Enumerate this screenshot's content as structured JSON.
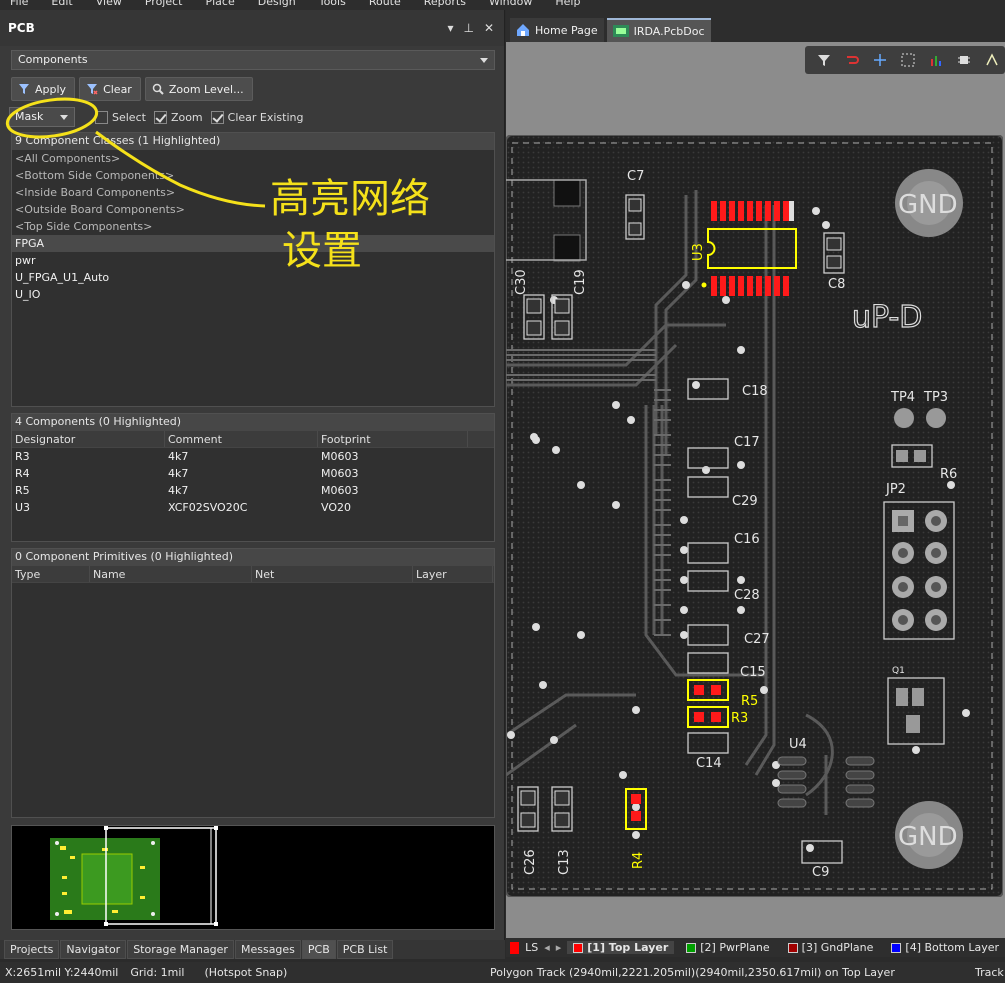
{
  "menu": [
    "File",
    "Edit",
    "View",
    "Project",
    "Place",
    "Design",
    "Tools",
    "Route",
    "Reports",
    "Window",
    "Help"
  ],
  "panel": {
    "title": "PCB",
    "mode": "Components",
    "buttons": {
      "apply": "Apply",
      "clear": "Clear",
      "zoom_level": "Zoom Level..."
    },
    "mask": "Mask",
    "options": {
      "select": "Select",
      "zoom": "Zoom",
      "clear_existing": "Clear Existing"
    },
    "classes": {
      "header": "9 Component Classes (1 Highlighted)",
      "items": [
        "<All Components>",
        "<Bottom Side Components>",
        "<Inside Board Components>",
        "<Outside Board Components>",
        "<Top Side Components>",
        "FPGA",
        "pwr",
        "U_FPGA_U1_Auto",
        "U_IO"
      ]
    },
    "components": {
      "header": "4 Components (0 Highlighted)",
      "columns": [
        "Designator",
        "Comment",
        "Footprint"
      ],
      "rows": [
        [
          "R3",
          "4k7",
          "M0603"
        ],
        [
          "R4",
          "4k7",
          "M0603"
        ],
        [
          "R5",
          "4k7",
          "M0603"
        ],
        [
          "U3",
          "XCF02SVO20C",
          "VO20"
        ]
      ]
    },
    "primitives": {
      "header": "0 Component Primitives (0 Highlighted)",
      "columns": [
        "Type",
        "Name",
        "Net",
        "Layer"
      ]
    },
    "bottom_tabs": [
      "Projects",
      "Navigator",
      "Storage Manager",
      "Messages",
      "PCB",
      "PCB List"
    ]
  },
  "annotation": {
    "line1": "高亮网络",
    "line2": "设置"
  },
  "doc_tabs": {
    "home": "Home Page",
    "pcb": "IRDA.PcbDoc"
  },
  "board_labels": {
    "gnd": "GND",
    "title": "uP-D",
    "c7": "C7",
    "u3": "U3",
    "c8": "C8",
    "c30": "C30",
    "c19": "C19",
    "c18": "C18",
    "tp4": "TP4",
    "tp3": "TP3",
    "c17": "C17",
    "r6": "R6",
    "c29": "C29",
    "jp2": "JP2",
    "c16": "C16",
    "c28": "C28",
    "c27": "C27",
    "c15": "C15",
    "q1": "Q1",
    "r5": "R5",
    "r3": "R3",
    "u4": "U4",
    "c14": "C14",
    "c26": "C26",
    "c13": "C13",
    "r4": "R4",
    "c9": "C9"
  },
  "layers": {
    "ls": "LS",
    "items": [
      {
        "name": "[1] Top Layer",
        "color": "#ff0000"
      },
      {
        "name": "[2] PwrPlane",
        "color": "#00a000"
      },
      {
        "name": "[3] GndPlane",
        "color": "#a00000"
      },
      {
        "name": "[4] Bottom Layer",
        "color": "#0000ff"
      }
    ]
  },
  "status": {
    "coords": "X:2651mil Y:2440mil",
    "grid": "Grid: 1mil",
    "snap": "(Hotspot Snap)",
    "info": "Polygon Track (2940mil,2221.205mil)(2940mil,2350.617mil) on Top Layer",
    "track": "Track:"
  },
  "colors": {
    "highlight": "#ffff00",
    "pad": "#ff0000",
    "silk": "#e6e6e6"
  }
}
